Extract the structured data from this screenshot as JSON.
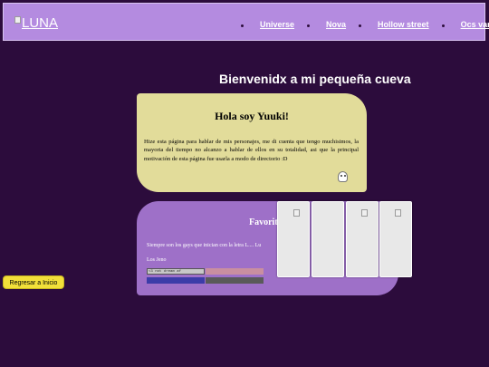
{
  "header": {
    "logo_text": "LUNA",
    "nav": [
      "Universe",
      "Nova",
      "Hollow street",
      "Ocs variados"
    ]
  },
  "main": {
    "heading": "Bienvenidx a mi pequeña cueva"
  },
  "intro_card": {
    "title": "Hola soy Yuuki!",
    "body": "Hize esta página para hablar de mis personajes, me di cuenta que tengo muchisimos, la mayoria del tiempo no alcanzo a hablar de ellos en su totalidad, asi que la principal motivación de esta página fue usarla a modo de directorio :D"
  },
  "favorites_card": {
    "title": "Favorit",
    "line1": "Siempre son los gays que inician con la letra L.... Lu",
    "line2": "Los Jeno",
    "badges": [
      "<3 not dream af",
      "",
      "",
      ""
    ]
  },
  "back_button": "Regresar a Inicio"
}
